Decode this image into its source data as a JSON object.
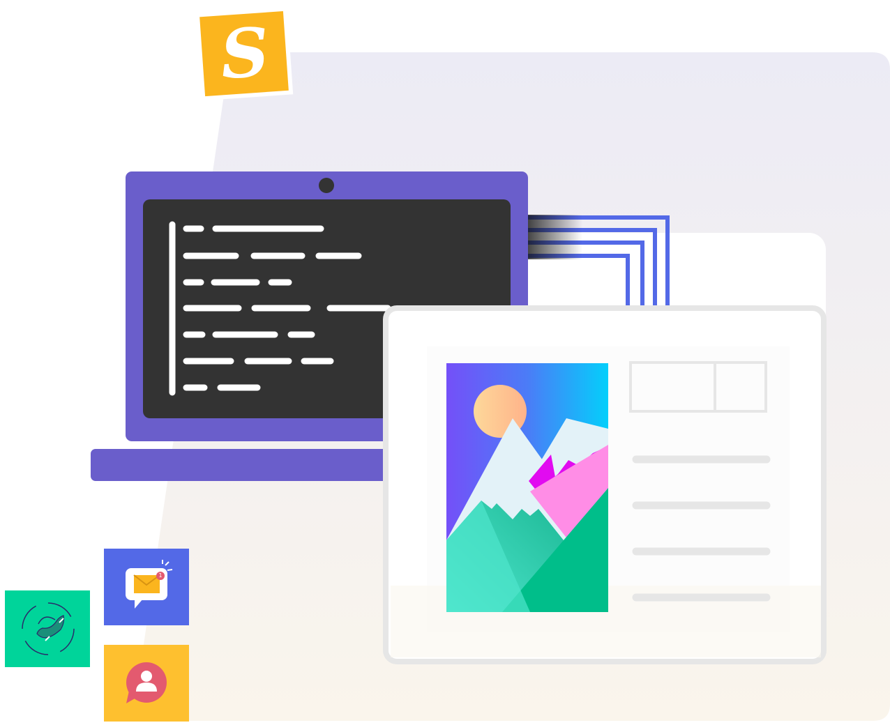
{
  "stamp": {
    "letter": "S"
  },
  "notifications": {
    "mail_count": "1"
  },
  "colors": {
    "backdrop_top": "#ECEBF5",
    "backdrop_bottom": "#FAF5EC",
    "laptop": "#6A5ECB",
    "screen": "#333333",
    "stamp": "#FBB51E",
    "window_border": "#E6E6E6",
    "blue_frames": "#5369E7",
    "phone_tile": "#00D49A",
    "mail_tile": "#5369E7",
    "user_tile": "#FEC02F",
    "user_badge": "#E35A6F"
  },
  "icons": {
    "stamp": "script-s-stamp-icon",
    "phone": "phone-call-icon",
    "mail": "envelope-notification-icon",
    "user": "user-chat-icon",
    "picture": "mountain-landscape-picture-icon",
    "webcam": "webcam-icon"
  }
}
